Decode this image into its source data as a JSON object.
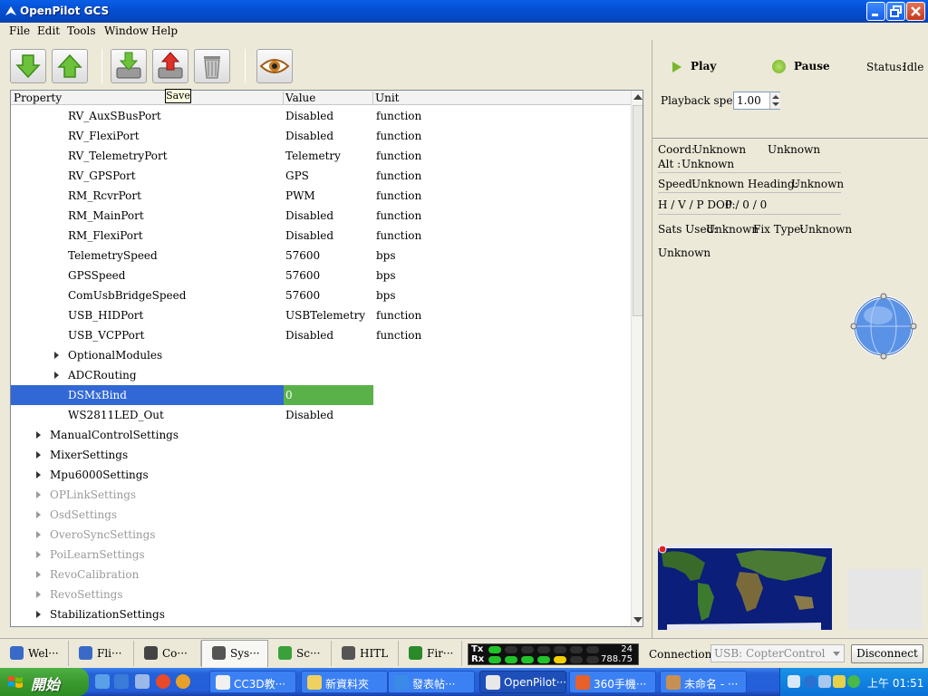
{
  "window": {
    "title": "OpenPilot GCS"
  },
  "menu": [
    "File",
    "Edit",
    "Tools",
    "Window",
    "Help"
  ],
  "toolbar": {
    "buttons": [
      "download-icon",
      "upload-icon",
      "load-icon",
      "save-icon",
      "delete-icon",
      "eye-icon"
    ],
    "tooltip": "Save"
  },
  "tree": {
    "headers": {
      "property": "Property",
      "value": "Value",
      "unit": "Unit"
    },
    "rows": [
      {
        "name": "RV_AuxSBusPort",
        "value": "Disabled",
        "unit": "function",
        "indent": 2
      },
      {
        "name": "RV_FlexiPort",
        "value": "Disabled",
        "unit": "function",
        "indent": 2
      },
      {
        "name": "RV_TelemetryPort",
        "value": "Telemetry",
        "unit": "function",
        "indent": 2
      },
      {
        "name": "RV_GPSPort",
        "value": "GPS",
        "unit": "function",
        "indent": 2
      },
      {
        "name": "RM_RcvrPort",
        "value": "PWM",
        "unit": "function",
        "indent": 2
      },
      {
        "name": "RM_MainPort",
        "value": "Disabled",
        "unit": "function",
        "indent": 2
      },
      {
        "name": "RM_FlexiPort",
        "value": "Disabled",
        "unit": "function",
        "indent": 2
      },
      {
        "name": "TelemetrySpeed",
        "value": "57600",
        "unit": "bps",
        "indent": 2
      },
      {
        "name": "GPSSpeed",
        "value": "57600",
        "unit": "bps",
        "indent": 2
      },
      {
        "name": "ComUsbBridgeSpeed",
        "value": "57600",
        "unit": "bps",
        "indent": 2
      },
      {
        "name": "USB_HIDPort",
        "value": "USBTelemetry",
        "unit": "function",
        "indent": 2
      },
      {
        "name": "USB_VCPPort",
        "value": "Disabled",
        "unit": "function",
        "indent": 2
      },
      {
        "name": "OptionalModules",
        "value": "",
        "unit": "",
        "indent": 2,
        "expandable": true
      },
      {
        "name": "ADCRouting",
        "value": "",
        "unit": "",
        "indent": 2,
        "expandable": true
      },
      {
        "name": "DSMxBind",
        "value": "0",
        "unit": "",
        "indent": 2,
        "selected": true
      },
      {
        "name": "WS2811LED_Out",
        "value": "Disabled",
        "unit": "",
        "indent": 2
      },
      {
        "name": "ManualControlSettings",
        "value": "",
        "unit": "",
        "indent": 1,
        "expandable": true
      },
      {
        "name": "MixerSettings",
        "value": "",
        "unit": "",
        "indent": 1,
        "expandable": true
      },
      {
        "name": "Mpu6000Settings",
        "value": "",
        "unit": "",
        "indent": 1,
        "expandable": true
      },
      {
        "name": "OPLinkSettings",
        "value": "",
        "unit": "",
        "indent": 1,
        "expandable": true,
        "dim": true
      },
      {
        "name": "OsdSettings",
        "value": "",
        "unit": "",
        "indent": 1,
        "expandable": true,
        "dim": true
      },
      {
        "name": "OveroSyncSettings",
        "value": "",
        "unit": "",
        "indent": 1,
        "expandable": true,
        "dim": true
      },
      {
        "name": "PoiLearnSettings",
        "value": "",
        "unit": "",
        "indent": 1,
        "expandable": true,
        "dim": true
      },
      {
        "name": "RevoCalibration",
        "value": "",
        "unit": "",
        "indent": 1,
        "expandable": true,
        "dim": true
      },
      {
        "name": "RevoSettings",
        "value": "",
        "unit": "",
        "indent": 1,
        "expandable": true,
        "dim": true
      },
      {
        "name": "StabilizationSettings",
        "value": "",
        "unit": "",
        "indent": 1,
        "expandable": true
      }
    ]
  },
  "playback": {
    "play_label": "Play",
    "pause_label": "Pause",
    "status_label": "Status:",
    "status_value": "Idle",
    "speed_label": "Playback speed:",
    "speed_value": "1.00"
  },
  "gps": {
    "coord_label": "Coord:",
    "coord_value": "Unknown",
    "coord_value2": "Unknown",
    "alt_label": "Alt :",
    "alt_value": "Unknown",
    "speed_label": "Speed:",
    "speed_value": "Unknown",
    "heading_label": "Heading:",
    "heading_value": "Unknown",
    "dop_label": "H / V / P DOP:",
    "dop_value": "0 / 0 / 0",
    "sats_label": "Sats Used:",
    "sats_value": "Unknown",
    "fix_label": "Fix Type:",
    "fix_value": "Unknown",
    "extra": "Unknown"
  },
  "tabs": [
    {
      "label": "Wel···",
      "icon": "wrench-icon"
    },
    {
      "label": "Fli···",
      "icon": "flight-icon"
    },
    {
      "label": "Co···",
      "icon": "config-icon"
    },
    {
      "label": "Sys···",
      "icon": "gear-icon",
      "active": true
    },
    {
      "label": "Sc···",
      "icon": "scope-icon"
    },
    {
      "label": "HITL",
      "icon": "gamepad-icon"
    },
    {
      "label": "Fir···",
      "icon": "chip-icon"
    }
  ],
  "telemetry": {
    "tx_label": "Tx",
    "rx_label": "Rx",
    "tx_value": "24",
    "rx_value": "788.75"
  },
  "connection": {
    "label": "Connections:",
    "device": "USB: CopterControl",
    "disconnect_label": "Disconnect"
  },
  "taskbar": {
    "start_label": "開始",
    "tasks": [
      {
        "label": "CC3D教···",
        "icon": "document-icon"
      },
      {
        "label": "新資料夾",
        "icon": "folder-icon"
      },
      {
        "label": "發表帖···",
        "icon": "ie-icon"
      },
      {
        "label": "OpenPilot···",
        "icon": "openpilot-icon",
        "active": true
      },
      {
        "label": "360手機···",
        "icon": "chrome-icon"
      },
      {
        "label": "未命名 - ···",
        "icon": "paint-icon"
      }
    ],
    "clock": "上午 01:51"
  },
  "colors": {
    "selection": "#3168d5",
    "value_highlight": "#5ab14a",
    "accent": "#245edb"
  }
}
